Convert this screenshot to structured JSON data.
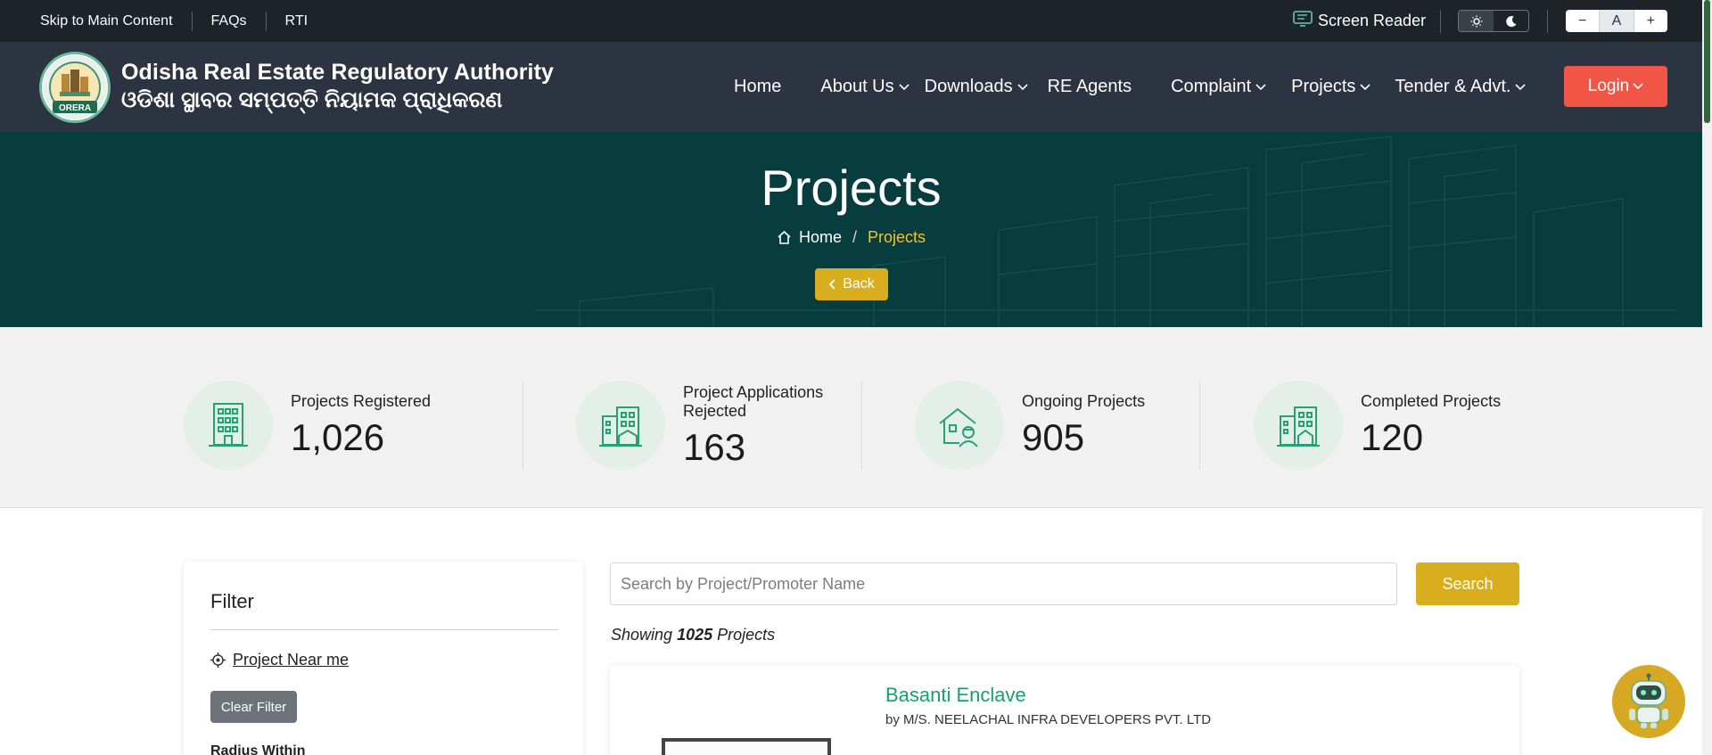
{
  "topbar": {
    "skip_link": "Skip to Main Content",
    "faqs": "FAQs",
    "rti": "RTI",
    "screen_reader": "Screen Reader",
    "font_decrease": "−",
    "font_reset": "A",
    "font_increase": "+"
  },
  "header": {
    "title_en": "Odisha Real Estate Regulatory Authority",
    "title_or": "ଓଡିଶା ସ୍ଥାବର ସମ୍ପତ୍ତି ନିୟାମକ ପ୍ରାଧିକରଣ",
    "logo_text": "ORERA",
    "nav": {
      "home": "Home",
      "about": "About Us",
      "downloads": "Downloads",
      "agents": "RE Agents",
      "complaint": "Complaint",
      "projects": "Projects",
      "tender": "Tender & Advt."
    },
    "login": "Login"
  },
  "hero": {
    "title": "Projects",
    "breadcrumb_home": "Home",
    "breadcrumb_sep": "/",
    "breadcrumb_current": "Projects",
    "back": "Back"
  },
  "stats": [
    {
      "label": "Projects Registered",
      "value": "1,026"
    },
    {
      "label": "Project Applications Rejected",
      "value": "163"
    },
    {
      "label": "Ongoing Projects",
      "value": "905"
    },
    {
      "label": "Completed Projects",
      "value": "120"
    }
  ],
  "filter": {
    "title": "Filter",
    "near_me": "Project Near me",
    "clear": "Clear Filter",
    "radius_label": "Radius Within"
  },
  "search": {
    "placeholder": "Search by Project/Promoter Name",
    "button": "Search"
  },
  "results": {
    "showing_prefix": "Showing",
    "count": "1025",
    "showing_suffix": "Projects"
  },
  "projects": [
    {
      "name": "Basanti Enclave",
      "promoter": "by M/S. NEELACHAL INFRA DEVELOPERS PVT. LTD"
    }
  ],
  "colors": {
    "topbar_bg": "#1e2329",
    "header_bg": "#2b3440",
    "hero_bg": "#083d3f",
    "accent_gold": "#d8ae1f",
    "login_red": "#f05545",
    "project_green": "#1aa06b"
  }
}
